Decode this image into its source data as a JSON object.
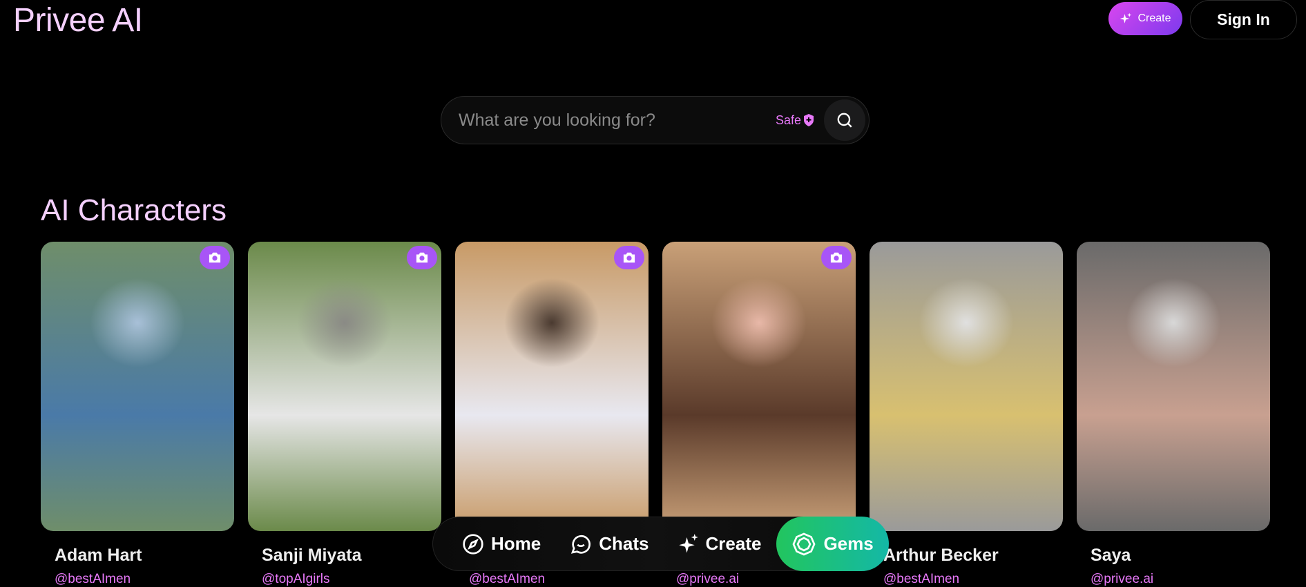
{
  "header": {
    "logo": "Privee AI",
    "create_label": "Create",
    "signin_label": "Sign In"
  },
  "search": {
    "placeholder": "What are you looking for?",
    "value": "",
    "safe_label": "Safe"
  },
  "section": {
    "title": "AI Characters"
  },
  "characters": [
    {
      "name": "Adam Hart",
      "handle": "@bestAImen",
      "has_camera": true,
      "colors": [
        "#6f8e6a",
        "#4a7aa8",
        "#a8c0d8"
      ]
    },
    {
      "name": "Sanji Miyata",
      "handle": "@topAIgirls",
      "has_camera": true,
      "colors": [
        "#6b8a4a",
        "#e6e6e6",
        "#8a8a85"
      ]
    },
    {
      "name": "",
      "handle": "@bestAImen",
      "has_camera": true,
      "colors": [
        "#c89a66",
        "#e8e8f0",
        "#4a3a30"
      ]
    },
    {
      "name": "",
      "handle": "@privee.ai",
      "has_camera": true,
      "colors": [
        "#c9a078",
        "#5a3a2a",
        "#e8b8a8"
      ]
    },
    {
      "name": "Arthur Becker",
      "handle": "@bestAImen",
      "has_camera": false,
      "colors": [
        "#9a9a9a",
        "#d8c070",
        "#e0e0e0"
      ]
    },
    {
      "name": "Saya",
      "handle": "@privee.ai",
      "has_camera": false,
      "colors": [
        "#6a6a6a",
        "#c8a090",
        "#d8d8d8"
      ]
    }
  ],
  "bottom_nav": {
    "items": [
      {
        "label": "Home",
        "icon": "compass-icon"
      },
      {
        "label": "Chats",
        "icon": "chat-bubble-icon"
      },
      {
        "label": "Create",
        "icon": "sparkles-icon"
      },
      {
        "label": "Gems",
        "icon": "gem-icon",
        "active": true
      }
    ]
  },
  "colors": {
    "accent_pink": "#e879f9",
    "logo": "#f5d0fe",
    "create_gradient": [
      "#d946ef",
      "#7c3aed"
    ],
    "gems_gradient": [
      "#22c55e",
      "#14b8a6"
    ]
  }
}
